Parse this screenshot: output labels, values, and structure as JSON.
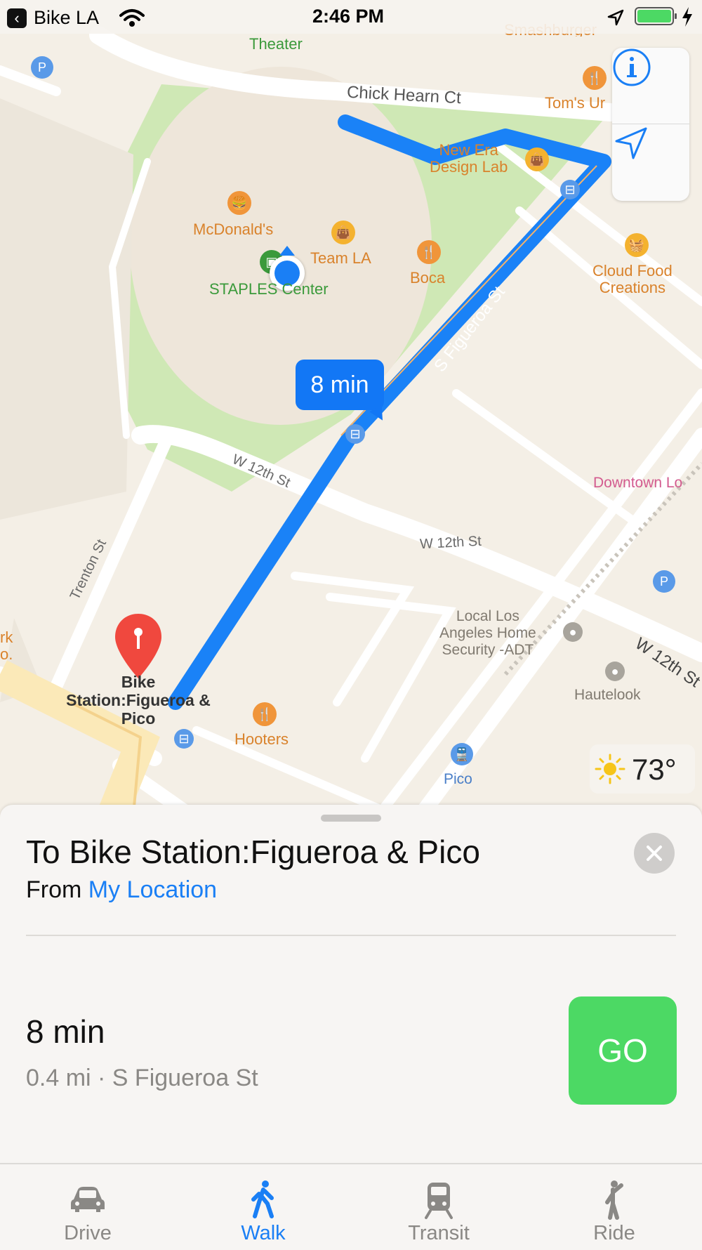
{
  "status_bar": {
    "back_app": "Bike LA",
    "time": "2:46 PM"
  },
  "map": {
    "labels": {
      "theater": "Theater",
      "smashburger": "Smashburger",
      "chick_hearn": "Chick Hearn Ct",
      "toms": "Tom's Ur",
      "new_era_1": "New Era",
      "new_era_2": "Design Lab",
      "mcdonalds": "McDonald's",
      "team_la": "Team LA",
      "boca": "Boca",
      "staples": "STAPLES Center",
      "cloud_food_1": "Cloud Food",
      "cloud_food_2": "Creations",
      "s_figueroa": "S Figueroa St",
      "w12_a": "W 12th St",
      "w12_b": "W 12th St",
      "w12_c": "W 12th St",
      "downtown": "Downtown Lo",
      "trenton": "Trenton St",
      "local_1": "Local Los",
      "local_2": "Angeles Home",
      "local_3": "Security -ADT",
      "hautelook": "Hautelook",
      "hooters": "Hooters",
      "pico": "Pico",
      "bike_1": "Bike",
      "bike_2": "Station:Figueroa &",
      "bike_3": "Pico",
      "edge_1": "rk",
      "edge_2": "o."
    },
    "eta_callout": "8 min",
    "weather_temp": "73°"
  },
  "card": {
    "title": "To Bike Station:Figueroa & Pico",
    "from_prefix": "From",
    "from_location": "My Location",
    "route_time": "8 min",
    "route_detail": "0.4 mi · S Figueroa St",
    "go_label": "GO"
  },
  "tabs": [
    {
      "label": "Drive",
      "icon": "car-icon",
      "active": false
    },
    {
      "label": "Walk",
      "icon": "walk-icon",
      "active": true
    },
    {
      "label": "Transit",
      "icon": "train-icon",
      "active": false
    },
    {
      "label": "Ride",
      "icon": "ride-icon",
      "active": false
    }
  ],
  "colors": {
    "accent": "#1a7ff5",
    "route": "#1a82f7",
    "go": "#4cd964",
    "pin": "#f0483e",
    "poi_orange": "#f0953a",
    "park": "#cfe8b5"
  }
}
